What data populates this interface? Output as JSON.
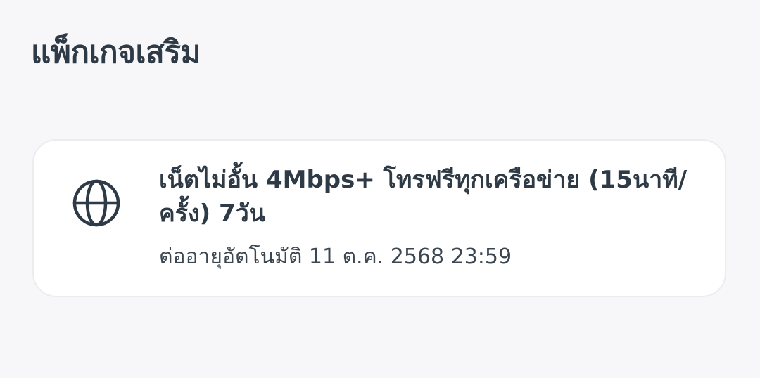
{
  "section": {
    "title": "แพ็กเกจเสริม"
  },
  "addon": {
    "icon": "globe-icon",
    "name": "เน็ตไม่อั้น 4Mbps+ โทรฟรีทุกเครือข่าย (15นาที/ครั้ง) 7วัน",
    "renewal": "ต่ออายุอัตโนมัติ 11 ต.ค. 2568 23:59"
  },
  "colors": {
    "background": "#f7f7f9",
    "card": "#ffffff",
    "text": "#2e3a45"
  }
}
